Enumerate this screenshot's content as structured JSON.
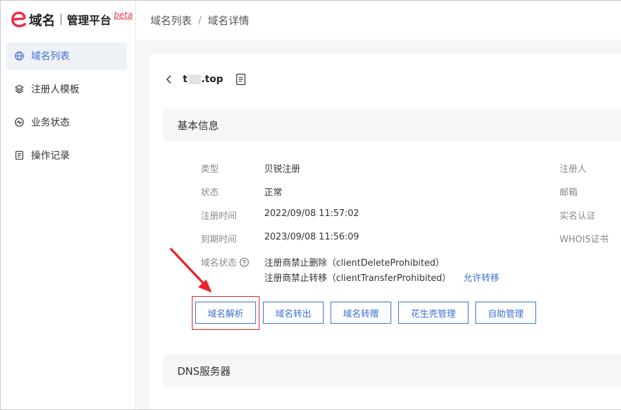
{
  "logo": {
    "name": "域名",
    "platform": "管理平台",
    "beta": "beta"
  },
  "sidebar": {
    "items": [
      {
        "label": "域名列表",
        "icon": "globe-icon",
        "active": true
      },
      {
        "label": "注册人模板",
        "icon": "layers-icon",
        "active": false
      },
      {
        "label": "业务状态",
        "icon": "pulse-icon",
        "active": false
      },
      {
        "label": "操作记录",
        "icon": "log-icon",
        "active": false
      }
    ]
  },
  "breadcrumb": {
    "items": [
      "域名列表",
      "域名详情"
    ],
    "separator": "/"
  },
  "domain": {
    "prefix": "t",
    "suffix": ".top"
  },
  "sections": {
    "basic_info": "基本信息",
    "dns": "DNS服务器"
  },
  "info": {
    "left": [
      {
        "label": "类型",
        "value": "贝锐注册"
      },
      {
        "label": "状态",
        "value": "正常"
      },
      {
        "label": "注册时间",
        "value": "2022/09/08 11:57:02"
      },
      {
        "label": "到期时间",
        "value": "2023/09/08 11:56:09"
      }
    ],
    "status_label": "域名状态",
    "status_lines": [
      "注册商禁止删除（clientDeleteProhibited）",
      "注册商禁止转移（clientTransferProhibited）"
    ],
    "allow_transfer_link": "允许转移",
    "right_labels": [
      "注册人",
      "邮箱",
      "实名认证",
      "WHOIS证书"
    ]
  },
  "actions": [
    "域名解析",
    "域名转出",
    "域名转赠",
    "花生壳管理",
    "自助管理"
  ],
  "colors": {
    "accent": "#3b6fd6",
    "brand": "#e8324a",
    "highlight": "#e02020"
  }
}
